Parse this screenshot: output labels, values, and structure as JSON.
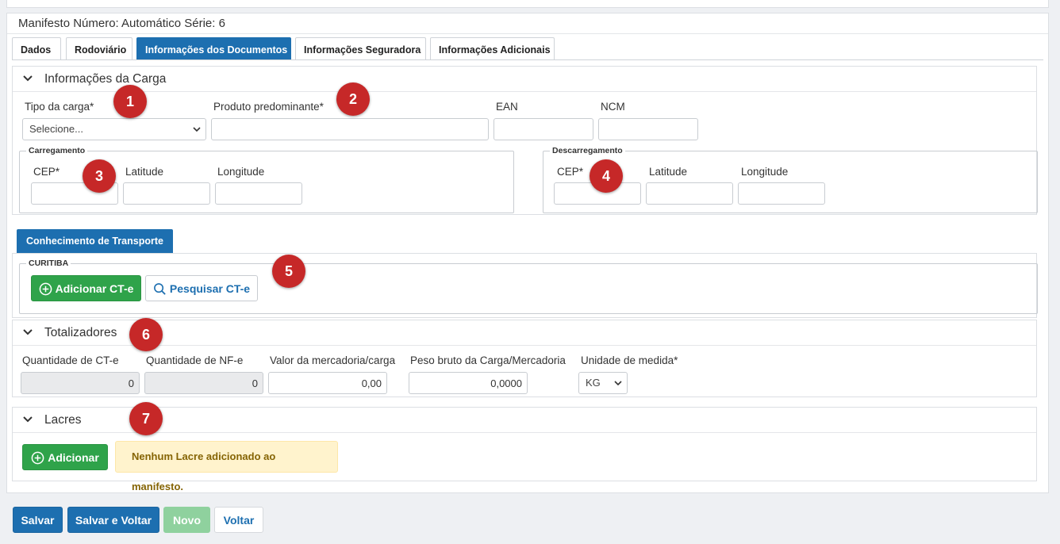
{
  "manifest": {
    "title": "Manifesto Número: Automático Série: 6"
  },
  "tabs": [
    {
      "label": "Dados"
    },
    {
      "label": "Rodoviário"
    },
    {
      "label": "Informações dos Documentos"
    },
    {
      "label": "Informações Seguradora"
    },
    {
      "label": "Informações Adicionais"
    }
  ],
  "carga": {
    "title": "Informações da Carga",
    "tipo_label": "Tipo da carga*",
    "tipo_value": "Selecione...",
    "produto_label": "Produto predominante*",
    "ean_label": "EAN",
    "ncm_label": "NCM",
    "carregamento": {
      "legend": "Carregamento",
      "cep": "CEP*",
      "lat": "Latitude",
      "lon": "Longitude"
    },
    "descarregamento": {
      "legend": "Descarregamento",
      "cep": "CEP*",
      "lat": "Latitude",
      "lon": "Longitude"
    }
  },
  "conhecimento": {
    "tab": "Conhecimento de Transporte",
    "legend": "CURITIBA",
    "add_label": "Adicionar CT-e",
    "search_label": "Pesquisar CT-e"
  },
  "totalizadores": {
    "title": "Totalizadores",
    "qtd_cte_label": "Quantidade de CT-e",
    "qtd_cte_value": "0",
    "qtd_nfe_label": "Quantidade de NF-e",
    "qtd_nfe_value": "0",
    "valor_label": "Valor da mercadoria/carga",
    "valor_value": "0,00",
    "peso_label": "Peso bruto da Carga/Mercadoria",
    "peso_value": "0,0000",
    "unidade_label": "Unidade de medida*",
    "unidade_value": "KG"
  },
  "lacres": {
    "title": "Lacres",
    "add_label": "Adicionar",
    "empty_message": "Nenhum Lacre adicionado ao manifesto."
  },
  "footer": {
    "salvar": "Salvar",
    "salvar_voltar": "Salvar e Voltar",
    "novo": "Novo",
    "voltar": "Voltar"
  },
  "badges": [
    "1",
    "2",
    "3",
    "4",
    "5",
    "6",
    "7"
  ],
  "colors": {
    "primary": "#1d6fb0",
    "success": "#2fa34a",
    "badge": "#c62828",
    "warning_bg": "#fff3cd",
    "warning_text": "#856404"
  }
}
